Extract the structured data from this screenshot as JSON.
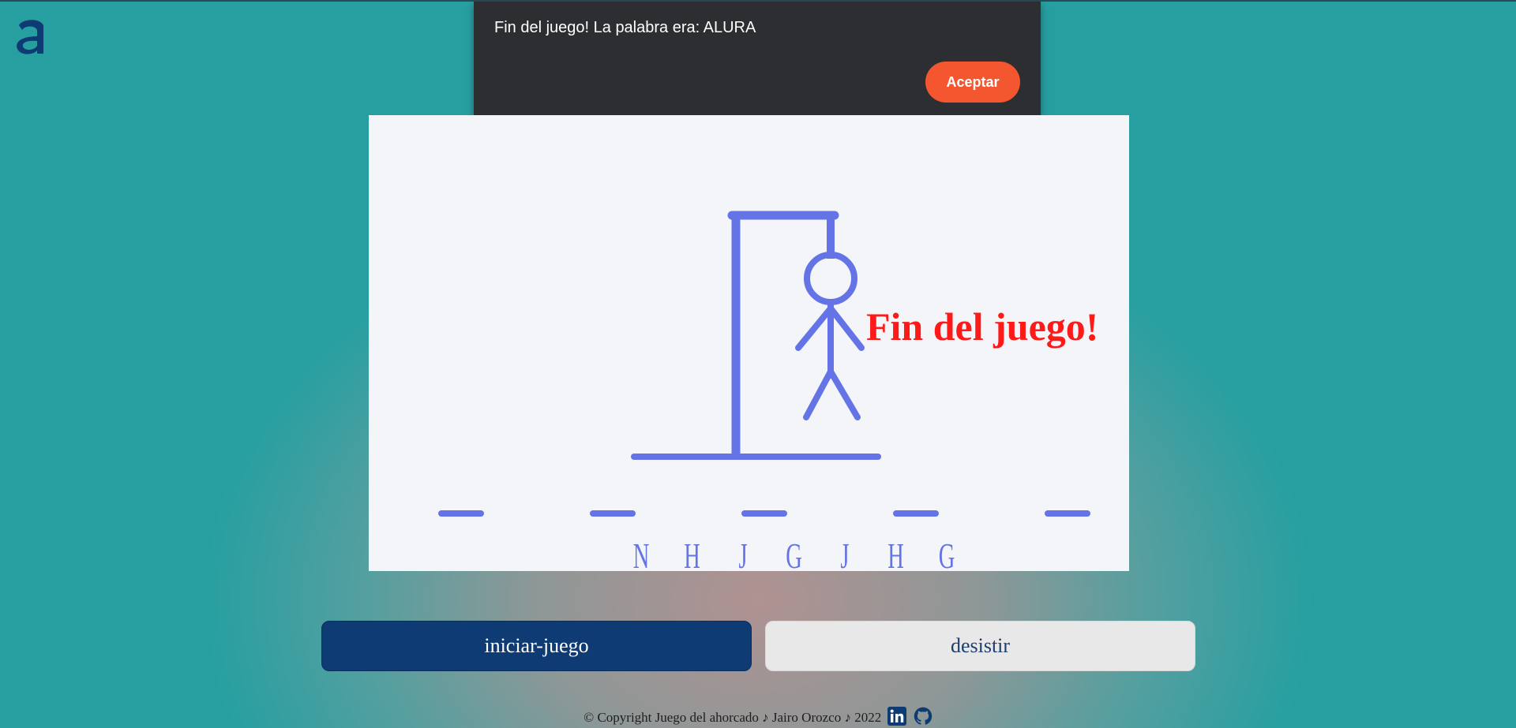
{
  "dialog": {
    "message": "Fin del juego! La palabra era: ALURA",
    "ok_label": "Aceptar"
  },
  "game": {
    "status_text": "Fin del juego!",
    "word_length": 5,
    "wrong_letters": [
      "N",
      "H",
      "J",
      "G",
      "J",
      "H",
      "G"
    ]
  },
  "buttons": {
    "start_label": "iniciar-juego",
    "quit_label": "desistir"
  },
  "footer": {
    "copyright": "© Copyright Juego del ahorcado ♪ Jairo Orozco ♪ 2022"
  },
  "colors": {
    "drawing": "#6473e6",
    "status": "#ff1a1a",
    "accent_button": "#f4572f",
    "primary_button": "#0f3b74",
    "logo": "#0f3b74",
    "linkedin": "#0f3b74",
    "github": "#0f3b74"
  },
  "icons": {
    "logo": "alura-logo-icon",
    "linkedin": "linkedin-icon",
    "github": "github-icon"
  }
}
